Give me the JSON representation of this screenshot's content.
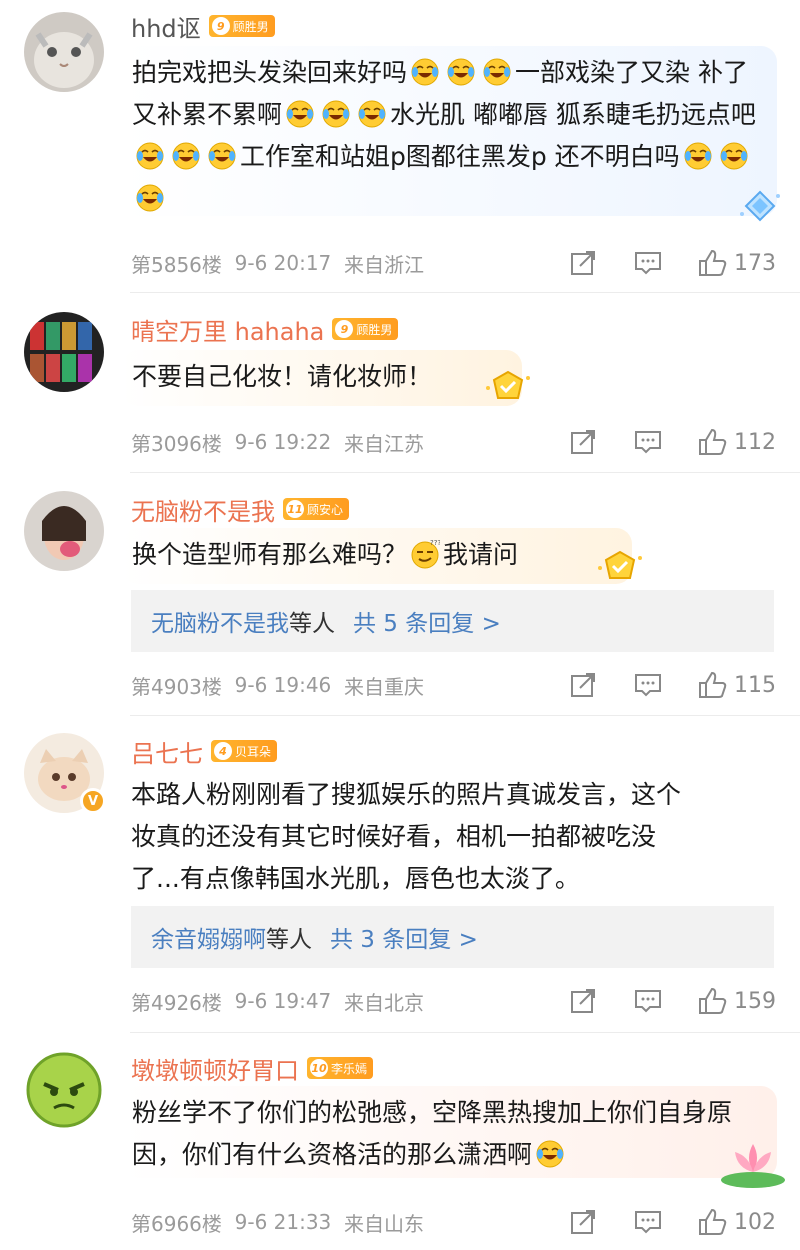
{
  "comments": [
    {
      "username": "hhd讴",
      "fan_level": "9",
      "fan_name": "顾胜男",
      "text_parts": [
        "拍完戏把头发染回来好吗",
        "一部戏染了又染 补了又补累不累啊",
        "水光肌 嘟嘟唇 狐系睫毛扔远点吧",
        "工作室和站姐p图都往黑发p 还不明白吗"
      ],
      "floor": "第5856楼",
      "date": "9-6 20:17",
      "location": "来自浙江",
      "likes": "173"
    },
    {
      "username": "晴空万里 hahaha",
      "fan_level": "9",
      "fan_name": "顾胜男",
      "text": "不要自己化妆！请化妆师！",
      "floor": "第3096楼",
      "date": "9-6 19:22",
      "location": "来自江苏",
      "likes": "112"
    },
    {
      "username": "无脑粉不是我",
      "fan_level": "11",
      "fan_name": "顾安心",
      "text_parts": [
        "换个造型师有那么难吗？",
        "我请问"
      ],
      "replies": {
        "names": "无脑粉不是我",
        "suffix": "等人",
        "total": "共 5 条回复 >"
      },
      "floor": "第4903楼",
      "date": "9-6 19:46",
      "location": "来自重庆",
      "likes": "115"
    },
    {
      "username": "吕七七",
      "fan_level": "4",
      "fan_name": "贝耳朵",
      "text_lines": [
        "本路人粉刚刚看了搜狐娱乐的照片真诚发言，这个",
        "妆真的还没有其它时候好看，相机一拍都被吃没",
        "了...有点像韩国水光肌，唇色也太淡了。"
      ],
      "replies": {
        "names": "余音嫋嫋啊",
        "suffix": "等人",
        "total": "共 3 条回复 >"
      },
      "floor": "第4926楼",
      "date": "9-6 19:47",
      "location": "来自北京",
      "likes": "159"
    },
    {
      "username": "墩墩顿顿好胃口",
      "fan_level": "10",
      "fan_name": "李乐嫣",
      "text_parts": [
        "粉丝学不了你们的松弛感，空降黑热搜加上你们自身原因，你们有什么资格活的那么潇洒啊"
      ],
      "floor": "第6966楼",
      "date": "9-6 21:33",
      "location": "来自山东",
      "likes": "102"
    }
  ],
  "colors": {
    "username_orange": "#eb7350",
    "link_blue": "#4a7fc0",
    "fan_badge": "#ff9c1f",
    "meta_gray": "#9a9a9a"
  },
  "icons": [
    "repost-icon",
    "comment-icon",
    "like-icon",
    "laugh-cry-emoji",
    "smirk-emoji",
    "verified-badge-icon",
    "diamond-badge-icon",
    "crown-badge-icon",
    "lotus-badge-icon"
  ]
}
